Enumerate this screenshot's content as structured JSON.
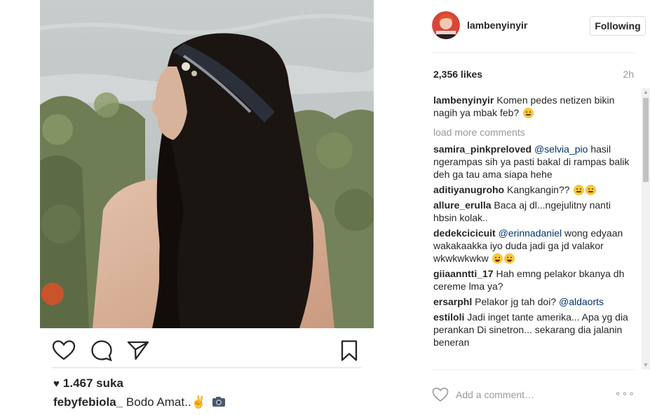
{
  "post": {
    "repost_likes": "1.467 suka",
    "repost_caption": {
      "username": "febyfebiola_",
      "text": " Bodo Amat..✌️"
    }
  },
  "panel": {
    "owner_username": "lambenyinyir",
    "follow_label": "Following",
    "likes": "2,356 likes",
    "time_ago": "2h",
    "load_more": "load more comments",
    "add_comment_placeholder": "Add a comment…",
    "more_options": "∘∘∘"
  },
  "comments": [
    {
      "username": "lambenyinyir",
      "text": "Komen pedes netizen bikin nagih ya mbak feb? ",
      "emoji": "yum"
    },
    {
      "username": "samira_pinkpreloved",
      "mention": "@selvia_pio",
      "text": " hasil ngerampas sih ya pasti bakal di rampas balik deh ga tau ama siapa hehe"
    },
    {
      "username": "aditiyanugroho",
      "text": "Kangkangin?? ",
      "emoji": "sad"
    },
    {
      "username": "allure_erulla",
      "text": "Baca aj dl...ngejulitny nanti hbsin kolak.."
    },
    {
      "username": "dedekcicicuit",
      "mention": "@erinnadaniel",
      "text": " wong edyaan wakakaakka iyo duda jadi ga jd valakor wkwkwkwkw ",
      "emoji": "joy"
    },
    {
      "username": "giiaanntti_17",
      "text": "Hah emng pelakor bkanya dh cereme lma ya?"
    },
    {
      "username": "ersarphl",
      "text": "Pelakor jg tah doi? ",
      "mention_end": "@aldaorts"
    },
    {
      "username": "estiloli",
      "text": "Jadi inget tante amerika... Apa yg dia perankan Di sinetron... sekarang dia jalanin beneran"
    }
  ],
  "colors": {
    "text": "#262626",
    "muted": "#999999",
    "mention": "#003569",
    "border": "#dbdbdb"
  },
  "icons": [
    "heart-icon",
    "comment-icon",
    "share-icon",
    "bookmark-icon",
    "camera-icon"
  ]
}
